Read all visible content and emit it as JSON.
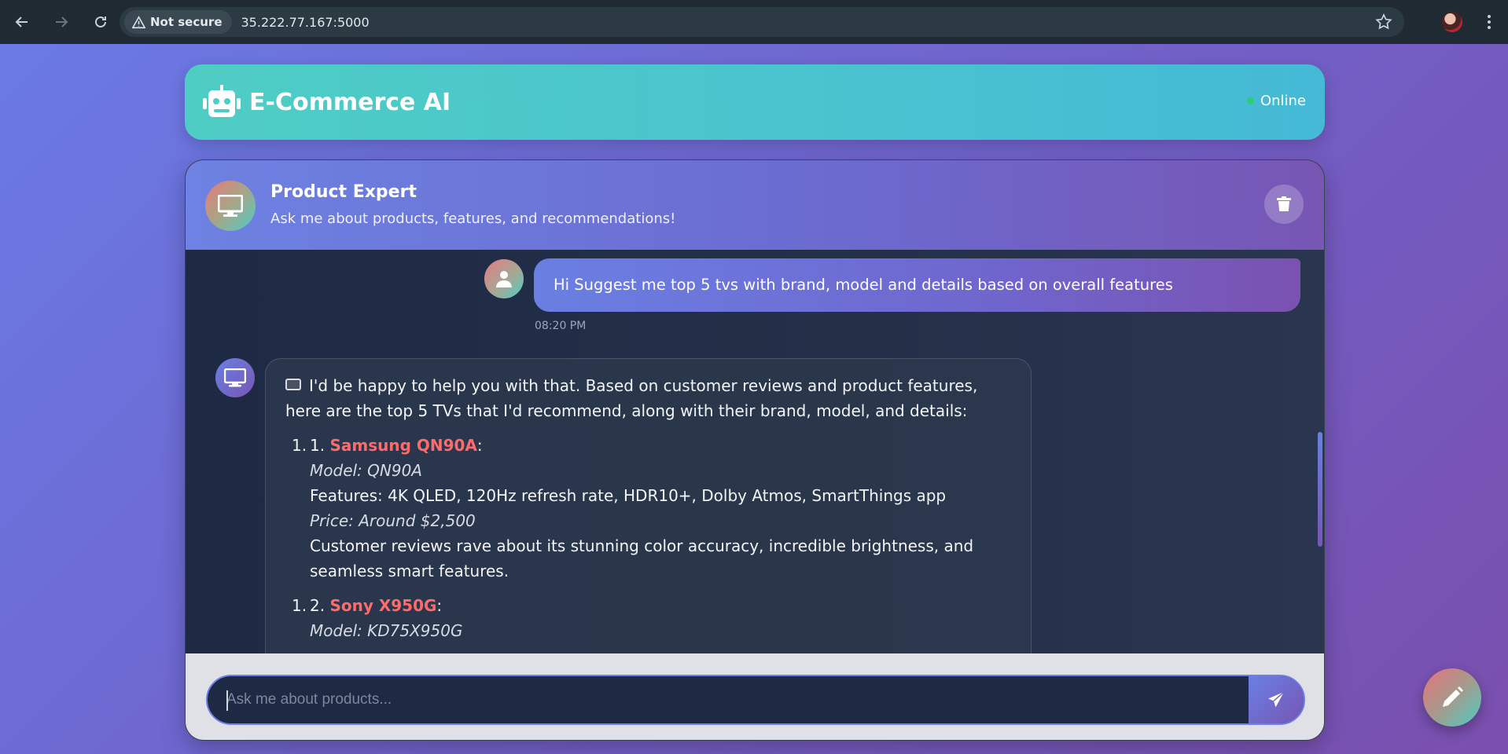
{
  "browser": {
    "security_label": "Not secure",
    "url": "35.222.77.167:5000"
  },
  "app": {
    "title": "E-Commerce AI",
    "status": "Online"
  },
  "chat": {
    "expert_name": "Product Expert",
    "expert_subtitle": "Ask me about products, features, and recommendations!",
    "user_message": "Hi Suggest me top 5 tvs with brand, model and details based on overall features",
    "user_time": "08:20 PM",
    "bot_intro": "I'd be happy to help you with that. Based on customer reviews and product features, here are the top 5 TVs that I'd recommend, along with their brand, model, and details:",
    "products": [
      {
        "marker": "1.",
        "number": "1.",
        "name": "Samsung QN90A",
        "model": "Model: QN90A",
        "features": "Features: 4K QLED, 120Hz refresh rate, HDR10+, Dolby Atmos, SmartThings app",
        "price": "Price: Around $2,500",
        "review": "Customer reviews rave about its stunning color accuracy, incredible brightness, and seamless smart features."
      },
      {
        "marker": "1.",
        "number": "2.",
        "name": "Sony X950G",
        "model": "Model: KD75X950G"
      }
    ],
    "input_placeholder": "Ask me about products..."
  }
}
